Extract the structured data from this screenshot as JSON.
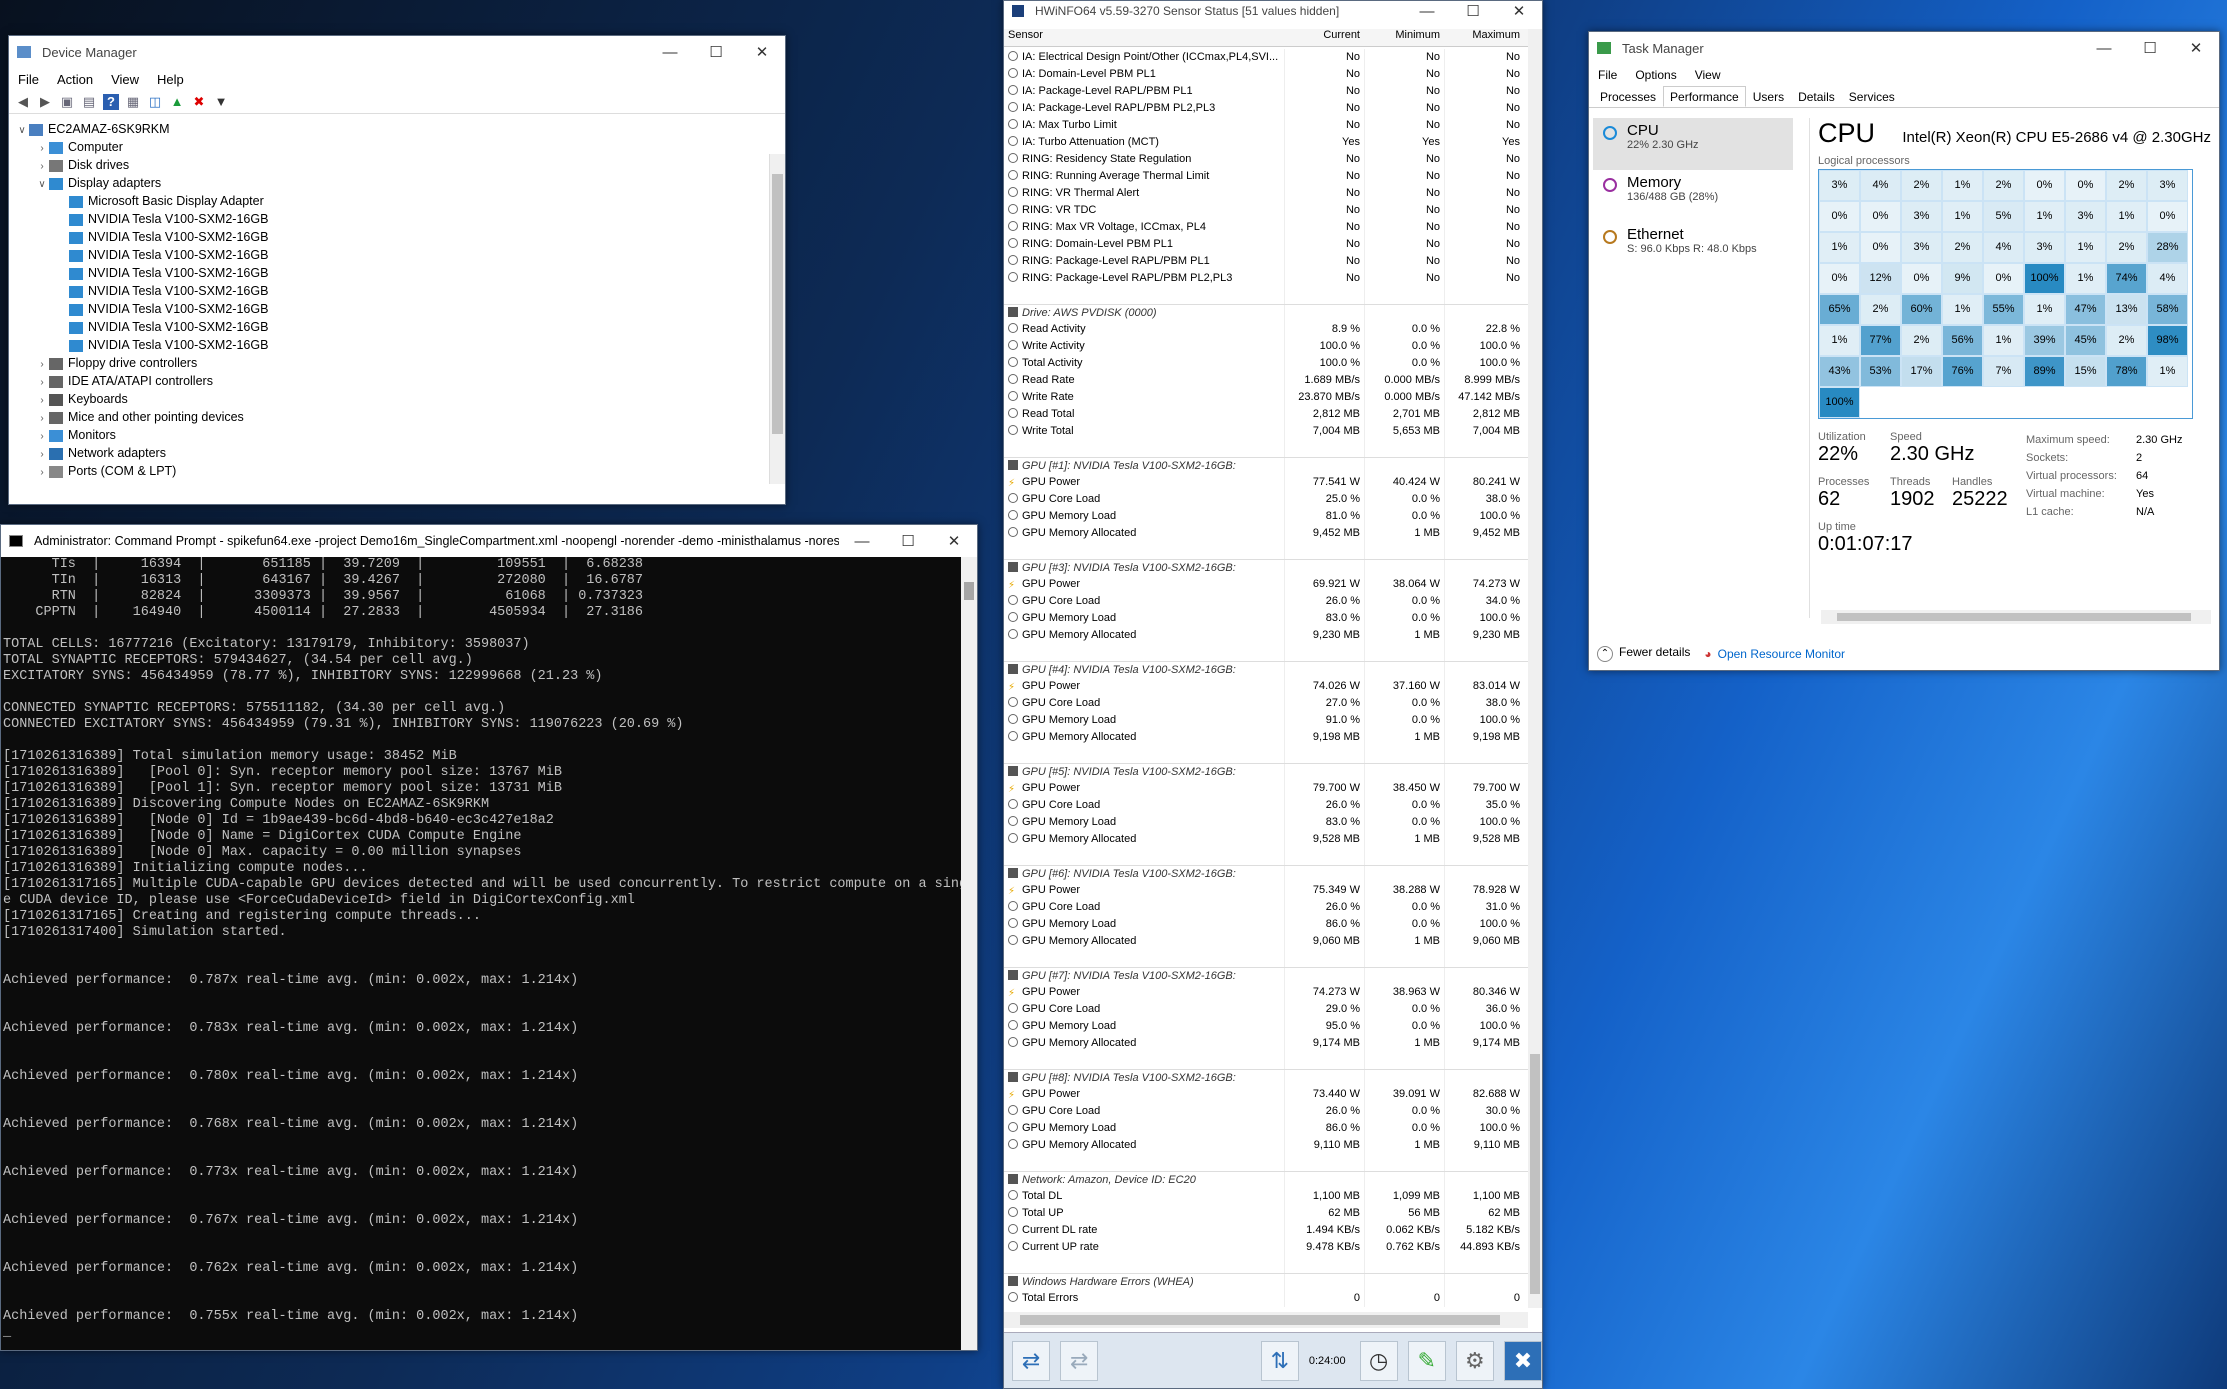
{
  "devmgr": {
    "title": "Device Manager",
    "menu": [
      "File",
      "Action",
      "View",
      "Help"
    ],
    "tree": [
      {
        "label": "EC2AMAZ-6SK9RKM",
        "level": 0,
        "exp": "v",
        "icon": "computer-icon"
      },
      {
        "label": "Computer",
        "level": 1,
        "exp": ">",
        "icon": "monitor-icon"
      },
      {
        "label": "Disk drives",
        "level": 1,
        "exp": ">",
        "icon": "disk-icon"
      },
      {
        "label": "Display adapters",
        "level": 1,
        "exp": "v",
        "icon": "display-icon"
      },
      {
        "label": "Microsoft Basic Display Adapter",
        "level": 2,
        "exp": "",
        "icon": "display-icon"
      },
      {
        "label": "NVIDIA Tesla V100-SXM2-16GB",
        "level": 2,
        "exp": "",
        "icon": "display-icon"
      },
      {
        "label": "NVIDIA Tesla V100-SXM2-16GB",
        "level": 2,
        "exp": "",
        "icon": "display-icon"
      },
      {
        "label": "NVIDIA Tesla V100-SXM2-16GB",
        "level": 2,
        "exp": "",
        "icon": "display-icon"
      },
      {
        "label": "NVIDIA Tesla V100-SXM2-16GB",
        "level": 2,
        "exp": "",
        "icon": "display-icon"
      },
      {
        "label": "NVIDIA Tesla V100-SXM2-16GB",
        "level": 2,
        "exp": "",
        "icon": "display-icon"
      },
      {
        "label": "NVIDIA Tesla V100-SXM2-16GB",
        "level": 2,
        "exp": "",
        "icon": "display-icon"
      },
      {
        "label": "NVIDIA Tesla V100-SXM2-16GB",
        "level": 2,
        "exp": "",
        "icon": "display-icon"
      },
      {
        "label": "NVIDIA Tesla V100-SXM2-16GB",
        "level": 2,
        "exp": "",
        "icon": "display-icon"
      },
      {
        "label": "Floppy drive controllers",
        "level": 1,
        "exp": ">",
        "icon": "controller-icon"
      },
      {
        "label": "IDE ATA/ATAPI controllers",
        "level": 1,
        "exp": ">",
        "icon": "controller-icon"
      },
      {
        "label": "Keyboards",
        "level": 1,
        "exp": ">",
        "icon": "keyboard-icon"
      },
      {
        "label": "Mice and other pointing devices",
        "level": 1,
        "exp": ">",
        "icon": "mouse-icon"
      },
      {
        "label": "Monitors",
        "level": 1,
        "exp": ">",
        "icon": "monitor-icon"
      },
      {
        "label": "Network adapters",
        "level": 1,
        "exp": ">",
        "icon": "network-icon"
      },
      {
        "label": "Ports (COM & LPT)",
        "level": 1,
        "exp": ">",
        "icon": "port-icon"
      }
    ]
  },
  "cmd": {
    "title": "Administrator: Command Prompt - spikefun64.exe  -project Demo16m_SingleCompartment.xml -noopengl -norender -demo -ministhalamus -noresize",
    "lines": [
      "      TIs  |     16394  |       651185 |  39.7209  |         109551  |  6.68238",
      "      TIn  |     16313  |       643167 |  39.4267  |         272080  |  16.6787",
      "      RTN  |     82824  |      3309373 |  39.9567  |          61068  | 0.737323",
      "    CPPTN  |    164940  |      4500114 |  27.2833  |        4505934  |  27.3186",
      "",
      "TOTAL CELLS: 16777216 (Excitatory: 13179179, Inhibitory: 3598037)",
      "TOTAL SYNAPTIC RECEPTORS: 579434627, (34.54 per cell avg.)",
      "EXCITATORY SYNS: 456434959 (78.77 %), INHIBITORY SYNS: 122999668 (21.23 %)",
      "",
      "CONNECTED SYNAPTIC RECEPTORS: 575511182, (34.30 per cell avg.)",
      "CONNECTED EXCITATORY SYNS: 456434959 (79.31 %), INHIBITORY SYNS: 119076223 (20.69 %)",
      "",
      "[1710261316389] Total simulation memory usage: 38452 MiB",
      "[1710261316389]   [Pool 0]: Syn. receptor memory pool size: 13767 MiB",
      "[1710261316389]   [Pool 1]: Syn. receptor memory pool size: 13731 MiB",
      "[1710261316389] Discovering Compute Nodes on EC2AMAZ-6SK9RKM",
      "[1710261316389]   [Node 0] Id = 1b9ae439-bc6d-4bd8-b640-ec3c427e18a2",
      "[1710261316389]   [Node 0] Name = DigiCortex CUDA Compute Engine",
      "[1710261316389]   [Node 0] Max. capacity = 0.00 million synapses",
      "[1710261316389] Initializing compute nodes...",
      "[1710261317165] Multiple CUDA-capable GPU devices detected and will be used concurrently. To restrict compute on a singl",
      "e CUDA device ID, please use <ForceCudaDeviceId> field in DigiCortexConfig.xml",
      "[1710261317165] Creating and registering compute threads...",
      "[1710261317400] Simulation started.",
      "",
      "",
      "Achieved performance:  0.787x real-time avg. (min: 0.002x, max: 1.214x)",
      "",
      "",
      "Achieved performance:  0.783x real-time avg. (min: 0.002x, max: 1.214x)",
      "",
      "",
      "Achieved performance:  0.780x real-time avg. (min: 0.002x, max: 1.214x)",
      "",
      "",
      "Achieved performance:  0.768x real-time avg. (min: 0.002x, max: 1.214x)",
      "",
      "",
      "Achieved performance:  0.773x real-time avg. (min: 0.002x, max: 1.214x)",
      "",
      "",
      "Achieved performance:  0.767x real-time avg. (min: 0.002x, max: 1.214x)",
      "",
      "",
      "Achieved performance:  0.762x real-time avg. (min: 0.002x, max: 1.214x)",
      "",
      "",
      "Achieved performance:  0.755x real-time avg. (min: 0.002x, max: 1.214x)",
      "_"
    ]
  },
  "hwinfo": {
    "title": "HWiNFO64 v5.59-3270 Sensor Status [51 values hidden]",
    "headers": [
      "Sensor",
      "Current",
      "Minimum",
      "Maximum"
    ],
    "rows": [
      [
        "IA: Electrical Design Point/Other (ICCmax,PL4,SVI...",
        "No",
        "No",
        "No",
        ""
      ],
      [
        "IA: Domain-Level PBM PL1",
        "No",
        "No",
        "No",
        ""
      ],
      [
        "IA: Package-Level RAPL/PBM PL1",
        "No",
        "No",
        "No",
        ""
      ],
      [
        "IA: Package-Level RAPL/PBM PL2,PL3",
        "No",
        "No",
        "No",
        ""
      ],
      [
        "IA: Max Turbo Limit",
        "No",
        "No",
        "No",
        ""
      ],
      [
        "IA: Turbo Attenuation (MCT)",
        "Yes",
        "Yes",
        "Yes",
        ""
      ],
      [
        "RING: Residency State Regulation",
        "No",
        "No",
        "No",
        ""
      ],
      [
        "RING: Running Average Thermal Limit",
        "No",
        "No",
        "No",
        ""
      ],
      [
        "RING: VR Thermal Alert",
        "No",
        "No",
        "No",
        ""
      ],
      [
        "RING: VR TDC",
        "No",
        "No",
        "No",
        ""
      ],
      [
        "RING: Max VR Voltage, ICCmax, PL4",
        "No",
        "No",
        "No",
        ""
      ],
      [
        "RING: Domain-Level PBM PL1",
        "No",
        "No",
        "No",
        ""
      ],
      [
        "RING: Package-Level RAPL/PBM PL1",
        "No",
        "No",
        "No",
        ""
      ],
      [
        "RING: Package-Level RAPL/PBM PL2,PL3",
        "No",
        "No",
        "No",
        ""
      ],
      [
        "",
        "",
        "",
        "",
        "sp"
      ],
      [
        "Drive: AWS PVDISK (0000)",
        "",
        "",
        "",
        "g"
      ],
      [
        "Read Activity",
        "8.9 %",
        "0.0 %",
        "22.8 %",
        ""
      ],
      [
        "Write Activity",
        "100.0 %",
        "0.0 %",
        "100.0 %",
        ""
      ],
      [
        "Total Activity",
        "100.0 %",
        "0.0 %",
        "100.0 %",
        ""
      ],
      [
        "Read Rate",
        "1.689 MB/s",
        "0.000 MB/s",
        "8.999 MB/s",
        ""
      ],
      [
        "Write Rate",
        "23.870 MB/s",
        "0.000 MB/s",
        "47.142 MB/s",
        ""
      ],
      [
        "Read Total",
        "2,812 MB",
        "2,701 MB",
        "2,812 MB",
        ""
      ],
      [
        "Write Total",
        "7,004 MB",
        "5,653 MB",
        "7,004 MB",
        ""
      ],
      [
        "",
        "",
        "",
        "",
        "sp"
      ],
      [
        "GPU [#1]: NVIDIA Tesla V100-SXM2-16GB:",
        "",
        "",
        "",
        "g"
      ],
      [
        "GPU Power",
        "77.541 W",
        "40.424 W",
        "80.241 W",
        "p"
      ],
      [
        "GPU Core Load",
        "25.0 %",
        "0.0 %",
        "38.0 %",
        ""
      ],
      [
        "GPU Memory Load",
        "81.0 %",
        "0.0 %",
        "100.0 %",
        ""
      ],
      [
        "GPU Memory Allocated",
        "9,452 MB",
        "1 MB",
        "9,452 MB",
        ""
      ],
      [
        "",
        "",
        "",
        "",
        "sp"
      ],
      [
        "GPU [#3]: NVIDIA Tesla V100-SXM2-16GB:",
        "",
        "",
        "",
        "g"
      ],
      [
        "GPU Power",
        "69.921 W",
        "38.064 W",
        "74.273 W",
        "p"
      ],
      [
        "GPU Core Load",
        "26.0 %",
        "0.0 %",
        "34.0 %",
        ""
      ],
      [
        "GPU Memory Load",
        "83.0 %",
        "0.0 %",
        "100.0 %",
        ""
      ],
      [
        "GPU Memory Allocated",
        "9,230 MB",
        "1 MB",
        "9,230 MB",
        ""
      ],
      [
        "",
        "",
        "",
        "",
        "sp"
      ],
      [
        "GPU [#4]: NVIDIA Tesla V100-SXM2-16GB:",
        "",
        "",
        "",
        "g"
      ],
      [
        "GPU Power",
        "74.026 W",
        "37.160 W",
        "83.014 W",
        "p"
      ],
      [
        "GPU Core Load",
        "27.0 %",
        "0.0 %",
        "38.0 %",
        ""
      ],
      [
        "GPU Memory Load",
        "91.0 %",
        "0.0 %",
        "100.0 %",
        ""
      ],
      [
        "GPU Memory Allocated",
        "9,198 MB",
        "1 MB",
        "9,198 MB",
        ""
      ],
      [
        "",
        "",
        "",
        "",
        "sp"
      ],
      [
        "GPU [#5]: NVIDIA Tesla V100-SXM2-16GB:",
        "",
        "",
        "",
        "g"
      ],
      [
        "GPU Power",
        "79.700 W",
        "38.450 W",
        "79.700 W",
        "p"
      ],
      [
        "GPU Core Load",
        "26.0 %",
        "0.0 %",
        "35.0 %",
        ""
      ],
      [
        "GPU Memory Load",
        "83.0 %",
        "0.0 %",
        "100.0 %",
        ""
      ],
      [
        "GPU Memory Allocated",
        "9,528 MB",
        "1 MB",
        "9,528 MB",
        ""
      ],
      [
        "",
        "",
        "",
        "",
        "sp"
      ],
      [
        "GPU [#6]: NVIDIA Tesla V100-SXM2-16GB:",
        "",
        "",
        "",
        "g"
      ],
      [
        "GPU Power",
        "75.349 W",
        "38.288 W",
        "78.928 W",
        "p"
      ],
      [
        "GPU Core Load",
        "26.0 %",
        "0.0 %",
        "31.0 %",
        ""
      ],
      [
        "GPU Memory Load",
        "86.0 %",
        "0.0 %",
        "100.0 %",
        ""
      ],
      [
        "GPU Memory Allocated",
        "9,060 MB",
        "1 MB",
        "9,060 MB",
        ""
      ],
      [
        "",
        "",
        "",
        "",
        "sp"
      ],
      [
        "GPU [#7]: NVIDIA Tesla V100-SXM2-16GB:",
        "",
        "",
        "",
        "g"
      ],
      [
        "GPU Power",
        "74.273 W",
        "38.963 W",
        "80.346 W",
        "p"
      ],
      [
        "GPU Core Load",
        "29.0 %",
        "0.0 %",
        "36.0 %",
        ""
      ],
      [
        "GPU Memory Load",
        "95.0 %",
        "0.0 %",
        "100.0 %",
        ""
      ],
      [
        "GPU Memory Allocated",
        "9,174 MB",
        "1 MB",
        "9,174 MB",
        ""
      ],
      [
        "",
        "",
        "",
        "",
        "sp"
      ],
      [
        "GPU [#8]: NVIDIA Tesla V100-SXM2-16GB:",
        "",
        "",
        "",
        "g"
      ],
      [
        "GPU Power",
        "73.440 W",
        "39.091 W",
        "82.688 W",
        "p"
      ],
      [
        "GPU Core Load",
        "26.0 %",
        "0.0 %",
        "30.0 %",
        ""
      ],
      [
        "GPU Memory Load",
        "86.0 %",
        "0.0 %",
        "100.0 %",
        ""
      ],
      [
        "GPU Memory Allocated",
        "9,110 MB",
        "1 MB",
        "9,110 MB",
        ""
      ],
      [
        "",
        "",
        "",
        "",
        "sp"
      ],
      [
        "Network: Amazon, Device ID: EC20",
        "",
        "",
        "",
        "g"
      ],
      [
        "Total DL",
        "1,100 MB",
        "1,099 MB",
        "1,100 MB",
        ""
      ],
      [
        "Total UP",
        "62 MB",
        "56 MB",
        "62 MB",
        ""
      ],
      [
        "Current DL rate",
        "1.494 KB/s",
        "0.062 KB/s",
        "5.182 KB/s",
        ""
      ],
      [
        "Current UP rate",
        "9.478 KB/s",
        "0.762 KB/s",
        "44.893 KB/s",
        ""
      ],
      [
        "",
        "",
        "",
        "",
        "sp"
      ],
      [
        "Windows Hardware Errors (WHEA)",
        "",
        "",
        "",
        "g"
      ],
      [
        "Total Errors",
        "0",
        "0",
        "0",
        ""
      ]
    ],
    "elapsed": "0:24:00"
  },
  "taskmgr": {
    "title": "Task Manager",
    "menu": [
      "File",
      "Options",
      "View"
    ],
    "tabs": [
      "Processes",
      "Performance",
      "Users",
      "Details",
      "Services"
    ],
    "left": [
      {
        "name": "CPU",
        "sub": "22% 2.30 GHz",
        "color": "#1a8ad8",
        "sel": true
      },
      {
        "name": "Memory",
        "sub": "136/488 GB (28%)",
        "color": "#9a2fa0",
        "sel": false
      },
      {
        "name": "Ethernet",
        "sub": "S: 96.0 Kbps  R: 48.0 Kbps",
        "color": "#b7791f",
        "sel": false
      }
    ],
    "cpu_label": "CPU",
    "cpu_model": "Intel(R) Xeon(R) CPU E5-2686 v4 @ 2.30GHz",
    "lp_label": "Logical processors",
    "cores": [
      "3%",
      "4%",
      "2%",
      "1%",
      "2%",
      "0%",
      "0%",
      "2%",
      "3%",
      "0%",
      "0%",
      "3%",
      "1%",
      "5%",
      "1%",
      "3%",
      "1%",
      "0%",
      "1%",
      "0%",
      "3%",
      "2%",
      "4%",
      "3%",
      "1%",
      "2%",
      "28%",
      "0%",
      "12%",
      "0%",
      "9%",
      "0%",
      "100%",
      "1%",
      "74%",
      "4%",
      "65%",
      "2%",
      "60%",
      "1%",
      "55%",
      "1%",
      "47%",
      "13%",
      "58%",
      "1%",
      "77%",
      "2%",
      "56%",
      "1%",
      "39%",
      "45%",
      "2%",
      "98%",
      "43%",
      "53%",
      "17%",
      "76%",
      "7%",
      "89%",
      "15%",
      "78%",
      "1%",
      "100%"
    ],
    "stats": {
      "utilization_label": "Utilization",
      "utilization": "22%",
      "speed_label": "Speed",
      "speed": "2.30 GHz",
      "processes_label": "Processes",
      "processes": "62",
      "threads_label": "Threads",
      "threads": "1902",
      "handles_label": "Handles",
      "handles": "25222",
      "uptime_label": "Up time",
      "uptime": "0:01:07:17"
    },
    "props": [
      [
        "Maximum speed:",
        "2.30 GHz"
      ],
      [
        "Sockets:",
        "2"
      ],
      [
        "Virtual processors:",
        "64"
      ],
      [
        "Virtual machine:",
        "Yes"
      ],
      [
        "L1 cache:",
        "N/A"
      ]
    ],
    "fewer": "Fewer details",
    "orm": "Open Resource Monitor"
  }
}
